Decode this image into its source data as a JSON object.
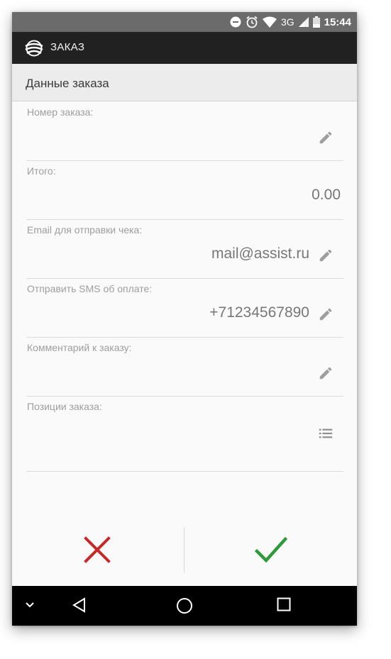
{
  "status_bar": {
    "network": "3G",
    "time": "15:44",
    "icons": [
      "do-not-disturb-icon",
      "alarm-icon",
      "wifi-icon",
      "signal-icon",
      "battery-icon"
    ]
  },
  "app_bar": {
    "title": "ЗАКАЗ",
    "icon": "assist-logo-icon"
  },
  "section": {
    "title": "Данные заказа"
  },
  "fields": [
    {
      "label": "Номер заказа:",
      "value": "",
      "icon": "pencil-icon"
    },
    {
      "label": "Итого:",
      "value": "0.00",
      "icon": ""
    },
    {
      "label": "Email для отправки чека:",
      "value": "mail@assist.ru",
      "icon": "pencil-icon"
    },
    {
      "label": "Отправить SMS об оплате:",
      "value": "+71234567890",
      "icon": "pencil-icon"
    },
    {
      "label": "Комментарий к заказу:",
      "value": "",
      "icon": "pencil-icon"
    },
    {
      "label": "Позиции заказа:",
      "value": "",
      "icon": "list-icon"
    }
  ],
  "actions": {
    "cancel_icon": "close-icon",
    "confirm_icon": "check-icon",
    "colors": {
      "cancel": "#c62828",
      "confirm": "#2e9a3a"
    }
  },
  "nav_bar": {
    "icons": [
      "chevron-down-icon",
      "back-icon",
      "home-icon",
      "recents-icon"
    ]
  },
  "colors": {
    "app_bar": "#212121",
    "status_bar": "#6b6b6b",
    "background": "#fafafa"
  }
}
